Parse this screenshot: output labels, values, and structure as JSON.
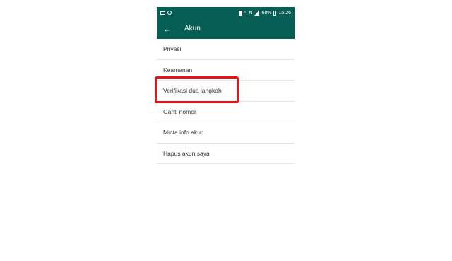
{
  "status_bar": {
    "left_icons": [
      "image-icon",
      "circle-icon"
    ],
    "right_icons": [
      "sim-icon",
      "wifi-icon",
      "nfc-icon",
      "signal-icon"
    ],
    "battery": "68%",
    "time": "15:26"
  },
  "app_bar": {
    "title": "Akun",
    "back_icon": "back-arrow-icon"
  },
  "menu": {
    "items": [
      {
        "label": "Privasi"
      },
      {
        "label": "Keamanan"
      },
      {
        "label": "Verifikasi dua langkah"
      },
      {
        "label": "Ganti nomor"
      },
      {
        "label": "Minta info akun"
      },
      {
        "label": "Hapus akun saya"
      }
    ]
  },
  "colors": {
    "header_green": "#075e54",
    "highlight_red": "#e8121b"
  }
}
